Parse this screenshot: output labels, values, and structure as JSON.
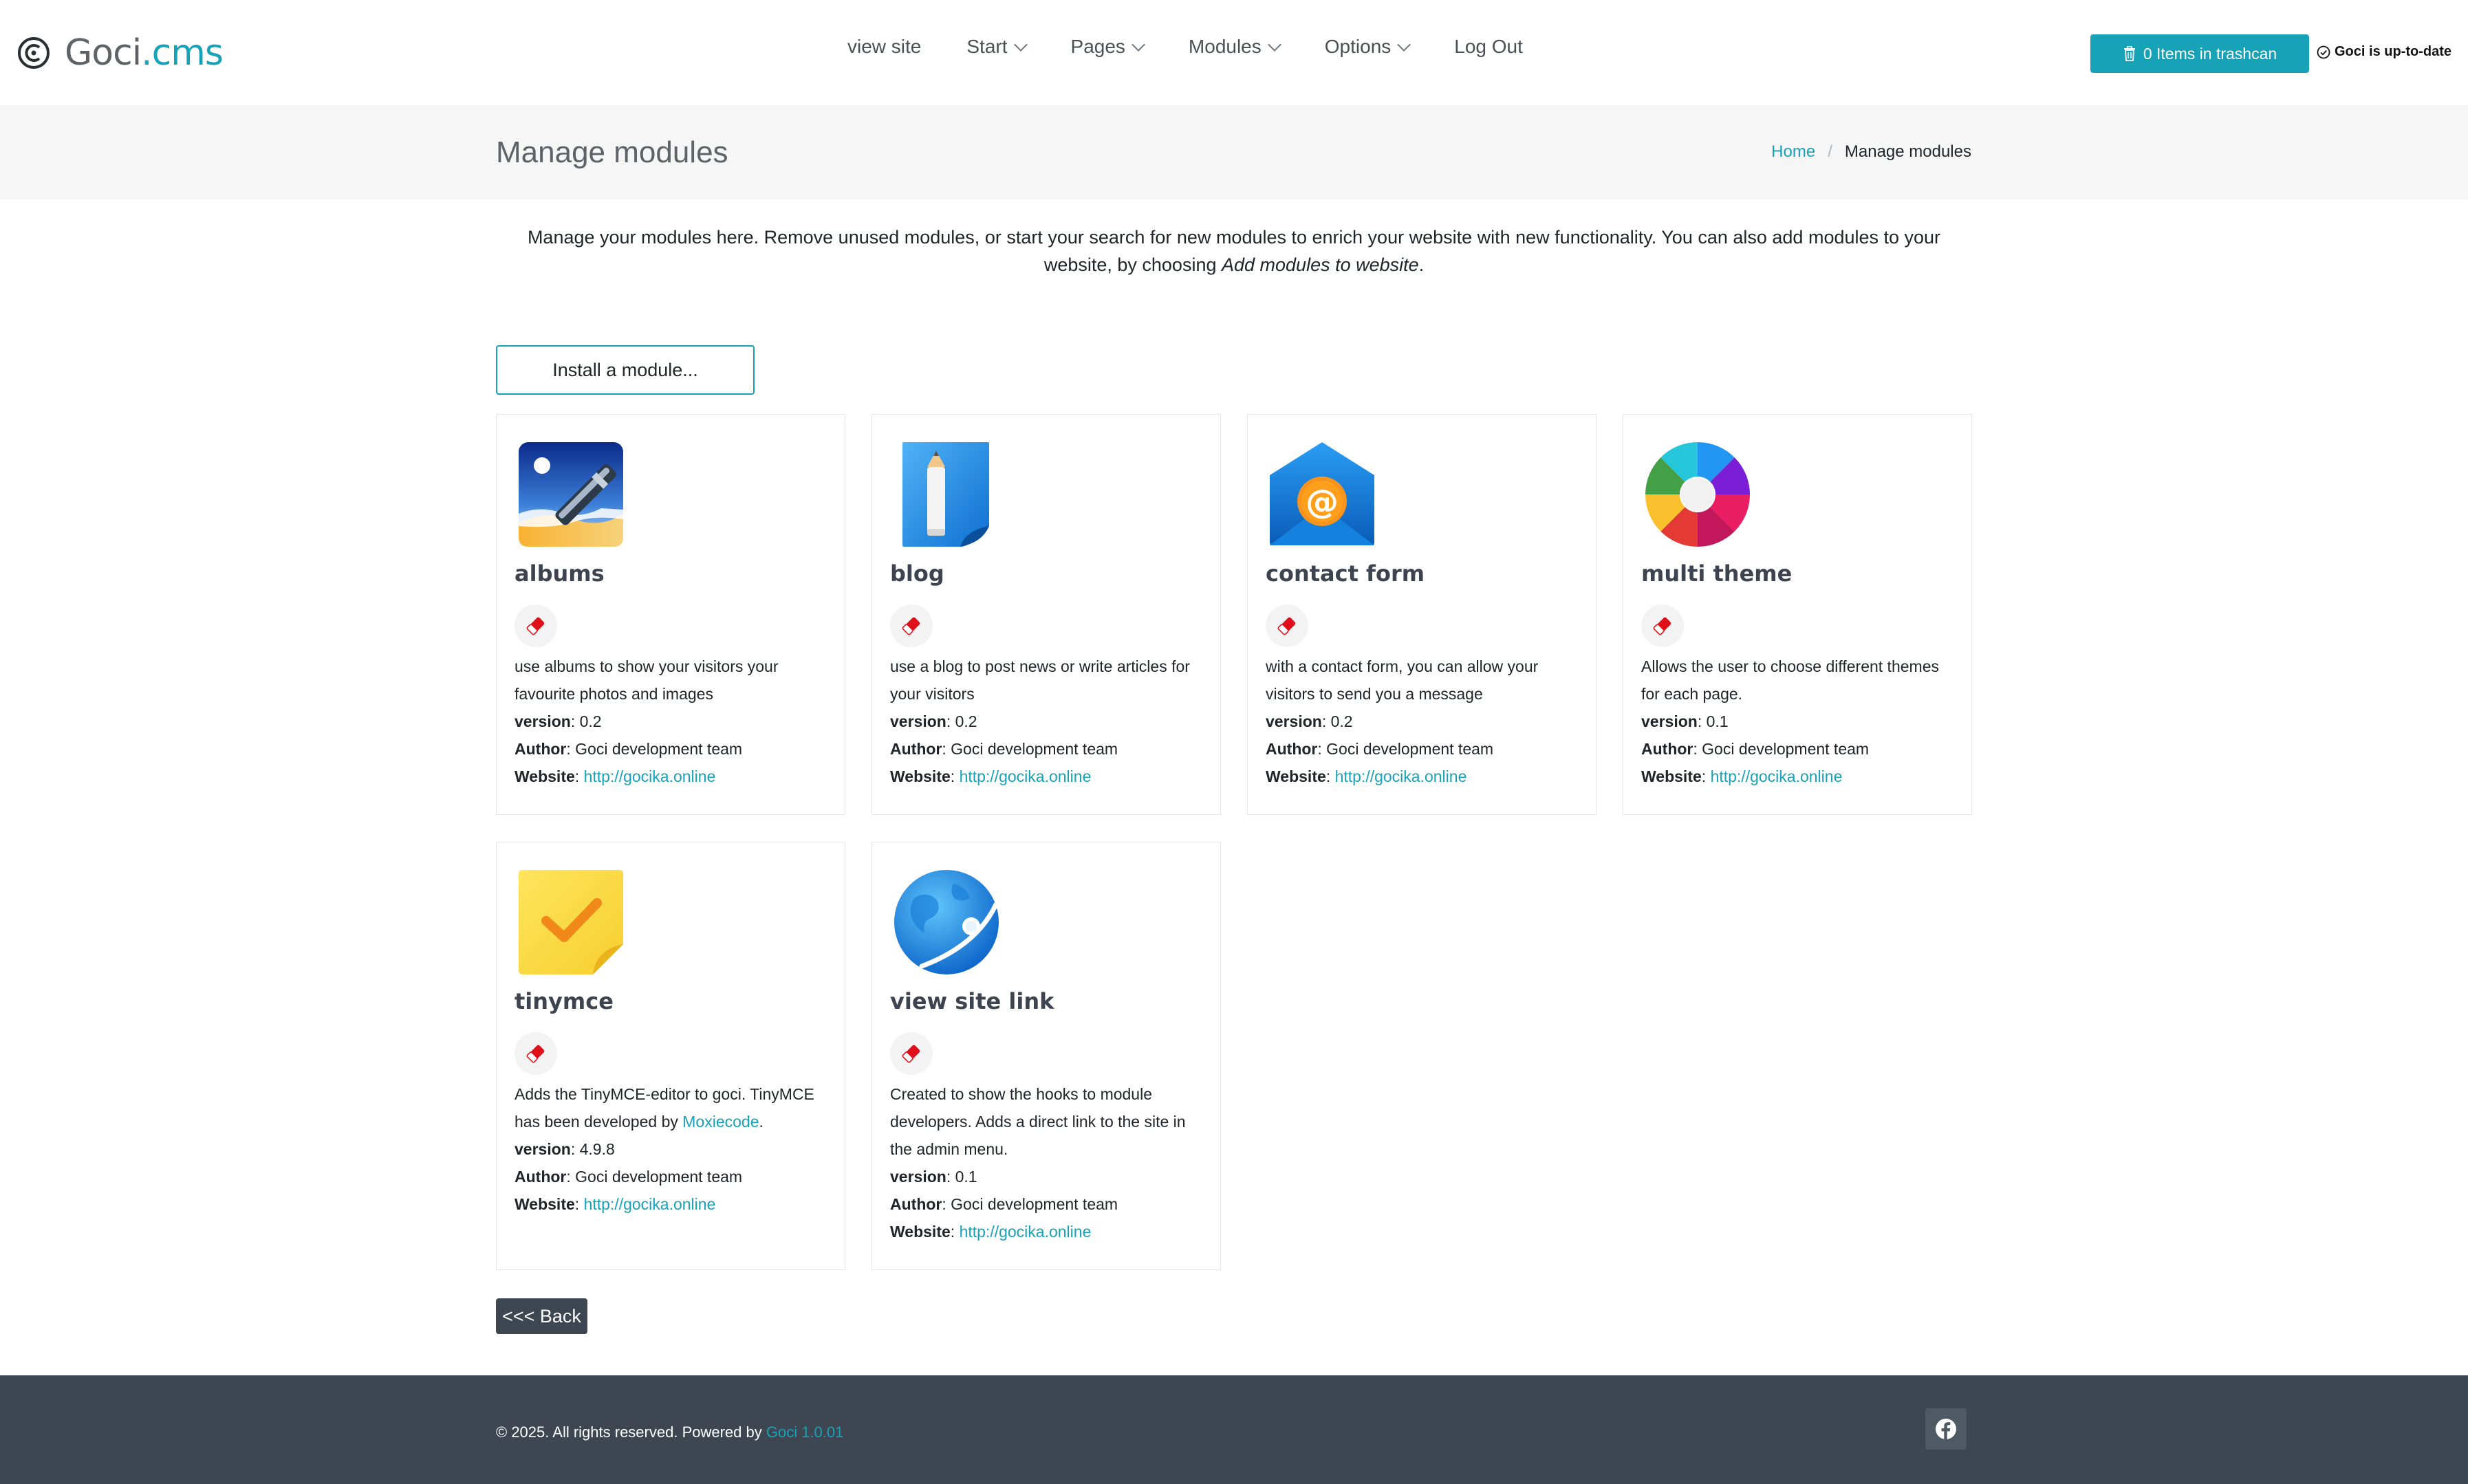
{
  "brand": {
    "name_part1": "Goci",
    "name_part2": ".cms",
    "accent": "#17a2b8"
  },
  "nav": {
    "items": [
      {
        "label": "view site",
        "dropdown": false
      },
      {
        "label": "Start",
        "dropdown": true
      },
      {
        "label": "Pages",
        "dropdown": true
      },
      {
        "label": "Modules",
        "dropdown": true
      },
      {
        "label": "Options",
        "dropdown": true
      },
      {
        "label": "Log Out",
        "dropdown": false
      }
    ]
  },
  "header": {
    "trash_label": "0 Items in trashcan",
    "trash_icon": "trash-icon",
    "status_label": "Goci is up-to-date",
    "status_icon": "check-circle-icon"
  },
  "page": {
    "title": "Manage modules",
    "breadcrumb": {
      "home": "Home",
      "current": "Manage modules",
      "separator": "/"
    },
    "intro_part1": "Manage your modules here. Remove unused modules, or start your search for new modules to enrich your website with new functionality. You can also add modules to your website, by choosing ",
    "intro_em": "Add modules to website",
    "intro_part2": ".",
    "install_label": "Install a module...",
    "back_label": "<<< Back"
  },
  "labels": {
    "version": "version",
    "author": "Author",
    "website": "Website"
  },
  "modules": [
    {
      "name": "albums",
      "icon": "albums-icon",
      "desc": "use albums to show your visitors your favourite photos and images",
      "version": "0.2",
      "author": "Goci development team",
      "website": "http://gocika.online"
    },
    {
      "name": "blog",
      "icon": "blog-icon",
      "desc": "use a blog to post news or write articles for your visitors",
      "version": "0.2",
      "author": "Goci development team",
      "website": "http://gocika.online"
    },
    {
      "name": "contact form",
      "icon": "contact-form-icon",
      "desc": "with a contact form, you can allow your visitors to send you a message",
      "version": "0.2",
      "author": "Goci development team",
      "website": "http://gocika.online"
    },
    {
      "name": "multi theme",
      "icon": "multi-theme-icon",
      "desc": "Allows the user to choose different themes for each page.",
      "version": "0.1",
      "author": "Goci development team",
      "website": "http://gocika.online"
    },
    {
      "name": "tinymce",
      "icon": "tinymce-icon",
      "desc": "Adds the TinyMCE-editor to goci. TinyMCE has been developed by ",
      "desc_link": "Moxiecode",
      "desc_end": ".",
      "version": "4.9.8",
      "author": "Goci development team",
      "website": "http://gocika.online"
    },
    {
      "name": "view site link",
      "icon": "view-site-link-icon",
      "desc": "Created to show the hooks to module developers. Adds a direct link to the site in the admin menu.",
      "version": "0.1",
      "author": "Goci development team",
      "website": "http://gocika.online"
    }
  ],
  "footer": {
    "copyright": "© 2025. All rights reserved. Powered by ",
    "powered_link": "Goci 1.0.01",
    "social_icon": "facebook-icon"
  }
}
